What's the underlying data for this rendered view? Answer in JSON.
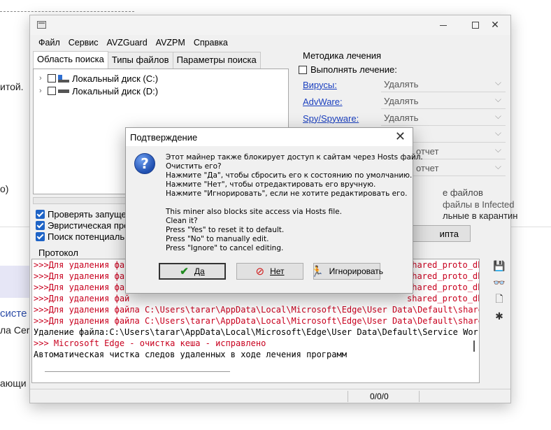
{
  "background": {
    "frag1": "итой.",
    "frag2": "o)",
    "frag3": "систе",
    "frag4": "ла Cer",
    "frag5": "ающи"
  },
  "window": {
    "menu": [
      "Файл",
      "Сервис",
      "AVZGuard",
      "AVZPM",
      "Справка"
    ],
    "tabs": [
      "Область поиска",
      "Типы файлов",
      "Параметры поиска"
    ],
    "drives": [
      "Локальный диск (C:)",
      "Локальный диск (D:)"
    ],
    "checks": [
      "Проверять запущен",
      "Эвристическая пров",
      "Поиск потенциальн"
    ],
    "treatment": {
      "group_title": "Методика лечения",
      "perform_label": "Выполнять лечение:",
      "rows": [
        {
          "label": "Вирусы:",
          "value": "Удалять"
        },
        {
          "label": "AdvWare:",
          "value": "Удалять"
        },
        {
          "label": "Spy/Spyware:",
          "value": "Удалять"
        }
      ],
      "hidden_values": [
        "ь",
        "отчет",
        "отчет"
      ],
      "text1": "е файлов",
      "text2": "файлы в  Infected",
      "text3": "льные в  карантин",
      "script_button": "ипта"
    },
    "protocol": {
      "label": "Протокол",
      "lines": [
        {
          "text": ">>>Для удаления файл",
          "tail": "shared_proto_db\\M",
          "red": true
        },
        {
          "text": ">>>Для удаления фай",
          "tail": "shared_proto_db\\n",
          "red": true
        },
        {
          "text": ">>>Для удаления фай",
          "tail": "shared_proto_db\\n",
          "red": true
        },
        {
          "text": ">>>Для удаления фай",
          "tail": "shared_proto_db\\n",
          "red": true
        },
        {
          "text": ">>>Для удаления файла C:\\Users\\tarar\\AppData\\Local\\Microsoft\\Edge\\User Data\\Default\\shared_proto_db\\n",
          "tail": "",
          "red": true
        },
        {
          "text": ">>>Для удаления файла C:\\Users\\tarar\\AppData\\Local\\Microsoft\\Edge\\User Data\\Default\\shared_proto_db\\n",
          "tail": "",
          "red": true
        },
        {
          "text": "Удаление файла:C:\\Users\\tarar\\AppData\\Local\\Microsoft\\Edge\\User Data\\Default\\Service Worker\\CacheStora",
          "tail": "",
          "red": false
        },
        {
          "text": " >>>  Microsoft Edge - очистка кеша - исправлено",
          "tail": "",
          "red": true
        },
        {
          "text": "Автоматическая чистка следов удаленных в ходе лечения программ",
          "tail": "",
          "red": false
        }
      ]
    },
    "status": "0/0/0"
  },
  "dialog": {
    "title": "Подтверждение",
    "message_ru": [
      "Этот майнер также блокирует доступ к сайтам через Hosts файл.",
      "Очистить его?",
      "Нажмите \"Да\", чтобы сбросить его к состоянию по умолчанию.",
      "Нажмите \"Нет\", чтобы отредактировать его вручную.",
      "Нажмите \"Игнорировать\", если не хотите редактировать его."
    ],
    "message_en": [
      "This miner also blocks site access via Hosts file.",
      "Clean it?",
      "Press \"Yes\" to reset it to default.",
      "Press \"No\" to manually edit.",
      "Press \"Ignore\" to cancel editing."
    ],
    "buttons": {
      "yes": "Да",
      "no": "Нет",
      "ignore": "Игнорировать"
    }
  }
}
